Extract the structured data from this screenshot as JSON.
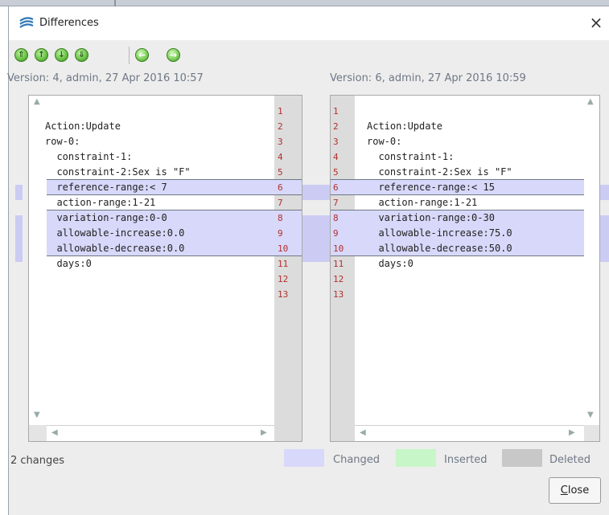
{
  "window": {
    "title": "Differences",
    "close_glyph": "×"
  },
  "toolbar": {
    "buttons": [
      {
        "icon": "first-change-icon",
        "glyph": "⇑"
      },
      {
        "icon": "previous-change-icon",
        "glyph": "↑"
      },
      {
        "icon": "next-change-icon",
        "glyph": "↓"
      },
      {
        "icon": "last-change-icon",
        "glyph": "⇓"
      },
      {
        "icon": "back-icon",
        "glyph": "←"
      },
      {
        "icon": "forward-icon",
        "glyph": "→"
      }
    ]
  },
  "left": {
    "version_label": "Version: 4, admin, 27 Apr 2016 10:57",
    "lines": [
      "",
      "Action:Update",
      "row-0:",
      "  constraint-1:",
      "  constraint-2:Sex is \"F\"",
      "  reference-range:< 7",
      "  action-range:1-21",
      "  variation-range:0-0",
      "  allowable-increase:0.0",
      "  allowable-decrease:0.0",
      "  days:0",
      "",
      ""
    ]
  },
  "right": {
    "version_label": "Version: 6, admin, 27 Apr 2016 10:59",
    "lines": [
      "",
      "Action:Update",
      "row-0:",
      "  constraint-1:",
      "  constraint-2:Sex is \"F\"",
      "  reference-range:< 15",
      "  action-range:1-21",
      "  variation-range:0-30",
      "  allowable-increase:75.0",
      "  allowable-decrease:50.0",
      "  days:0",
      "",
      ""
    ]
  },
  "line_numbers": [
    "1",
    "2",
    "3",
    "4",
    "5",
    "6",
    "7",
    "8",
    "9",
    "10",
    "11",
    "12",
    "13"
  ],
  "changed_line_numbers": [
    6,
    8,
    9,
    10
  ],
  "status": {
    "changes_text": "2 changes"
  },
  "legend": {
    "changed_label": "Changed",
    "inserted_label": "Inserted",
    "deleted_label": "Deleted",
    "changed_color": "#d8d8fb",
    "inserted_color": "#c7f6c9",
    "deleted_color": "#c8c8c8"
  },
  "close_button": {
    "label_underlined": "C",
    "label_rest": "lose"
  }
}
